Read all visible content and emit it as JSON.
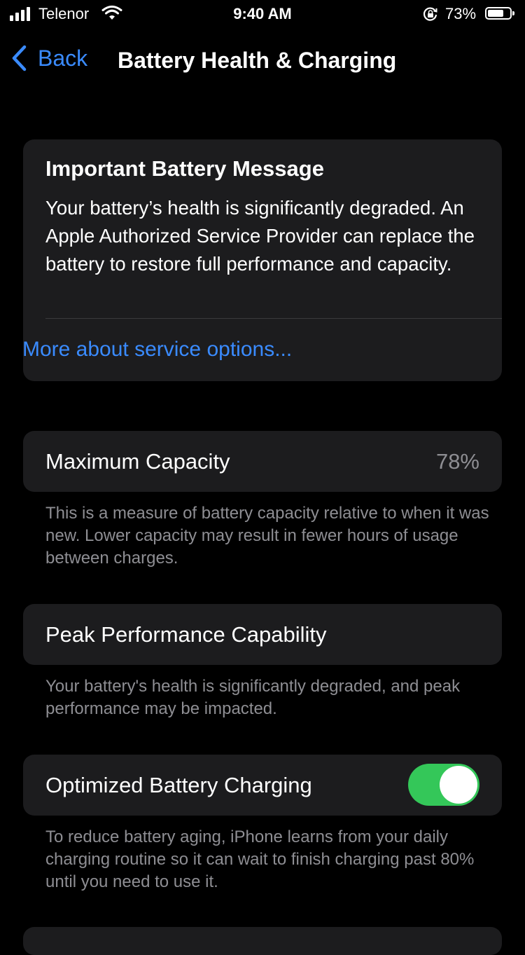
{
  "status_bar": {
    "carrier": "Telenor",
    "time": "9:40 AM",
    "battery_percent": "73%",
    "battery_level": 0.73,
    "icons": [
      "signal-bars-icon",
      "wifi-icon",
      "orientation-lock-icon",
      "battery-icon"
    ]
  },
  "nav": {
    "back_label": "Back",
    "title": "Battery Health & Charging"
  },
  "message_card": {
    "title": "Important Battery Message",
    "body": "Your battery’s health is significantly degraded. An Apple Authorized Service Provider can replace the battery to restore full performance and capacity.",
    "link": "More about service options..."
  },
  "max_capacity": {
    "label": "Maximum Capacity",
    "value": "78%",
    "footnote": "This is a measure of battery capacity relative to when it was new. Lower capacity may result in fewer hours of usage between charges."
  },
  "peak_performance": {
    "label": "Peak Performance Capability",
    "footnote": "Your battery's health is significantly degraded, and peak performance may be impacted."
  },
  "optimized_charging": {
    "label": "Optimized Battery Charging",
    "enabled": true,
    "footnote": "To reduce battery aging, iPhone learns from your daily charging routine so it can wait to finish charging past 80% until you need to use it."
  },
  "colors": {
    "accent": "#3a8bff",
    "toggle_on": "#34c759",
    "card_bg": "#1c1c1e",
    "secondary_text": "#8e8e93"
  }
}
